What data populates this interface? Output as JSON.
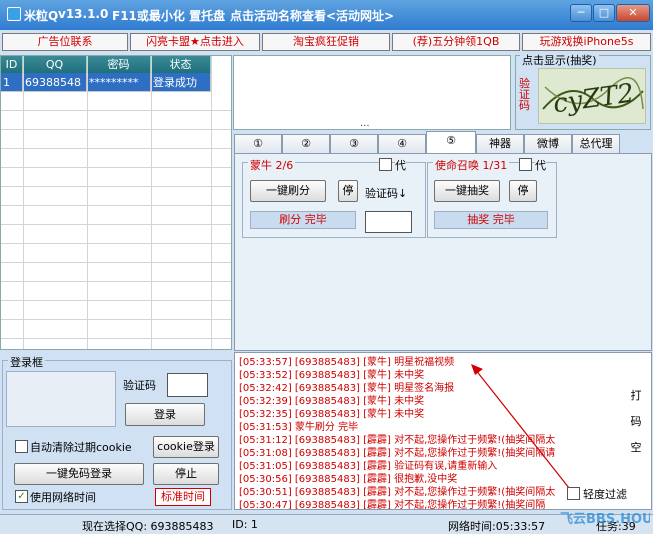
{
  "window": {
    "title": "米粒Q",
    "version": "v13.1.0",
    "shortcut_hint": "F11或最小化 置托盘",
    "link_hint": "点击活动名称查看<活动网址>",
    "minimize": "─",
    "maximize": "□",
    "close": "✕"
  },
  "ads": [
    "广告位联系",
    "闪亮卡盟★点击进入",
    "淘宝疯狂促销",
    "(荐)五分钟领1QB",
    "玩游戏换iPhone5s"
  ],
  "accounts": {
    "headers": [
      "ID",
      "QQ",
      "密码",
      "状态"
    ],
    "rows": [
      {
        "id": "1",
        "qq": "69388548",
        "password": "*********",
        "status": "登录成功"
      }
    ]
  },
  "display": {
    "dots": "...",
    "captcha_title": "点击显示(抽奖)",
    "captcha_label": "验证码",
    "captcha_image_text": "cyZT2"
  },
  "tabs": [
    "①",
    "②",
    "③",
    "④",
    "⑤",
    "神器",
    "微博",
    "总代理"
  ],
  "activity1": {
    "name": "蒙牛 2/6",
    "check_label": "代",
    "action": "一键刷分",
    "stop": "停",
    "captcha": "验证码↓",
    "status": "刷分 完毕"
  },
  "activity2": {
    "name": "使命召唤 1/31",
    "check_label": "代",
    "action": "一键抽奖",
    "stop": "停",
    "status": "抽奖  完毕"
  },
  "login": {
    "title": "登录框",
    "captcha_label": "验证码",
    "login_button": "登录",
    "auto_clear": "自动清除过期cookie",
    "cookie_login": "cookie登录",
    "one_key": "一键免码登录",
    "stop": "停止",
    "use_net_time": "使用网络时间",
    "standard_time": "标准时间"
  },
  "log": {
    "lines": [
      "[05:33:57] [693885483] [蒙牛] 明星祝福视频",
      "[05:33:52] [693885483] [蒙牛] 未中奖",
      "[05:32:42] [693885483] [蒙牛] 明星签名海报",
      "[05:32:39] [693885483] [蒙牛] 未中奖",
      "[05:32:35] [693885483] [蒙牛] 未中奖",
      "[05:31:53] 蒙牛刷分    完毕",
      "[05:31:12] [693885483] [霹霹] 对不起,您操作过于频繁!(抽奖间隔太",
      "[05:31:08] [693885483] [霹霹] 对不起,您操作过于频繁!(抽奖间隔请",
      "[05:31:05] [693885483] [霹霹] 验证码有误,请重新输入",
      "[05:30:56] [693885483] [霹霹] 很抱歉,没中奖",
      "[05:30:51] [693885483] [霹霹] 对不起,您操作过于频繁!(抽奖间隔太",
      "[05:30:47] [693885483] [霹霹] 对不起,您操作过于频繁!(抽奖间隔"
    ],
    "side_text": [
      "打",
      "码",
      "空"
    ],
    "filter_label": "轻度过滤"
  },
  "statusbar": {
    "current": "现在选择QQ: 693885483",
    "id": "ID: 1",
    "net_time": "网络时间:05:33:57",
    "tasks": "任务:39"
  },
  "watermark": "飞云BBS.HOUDAO.COM",
  "colors": {
    "accent_red": "#d00000",
    "title_blue": "#2f7bd0",
    "selected_row": "#2f6fc3"
  }
}
